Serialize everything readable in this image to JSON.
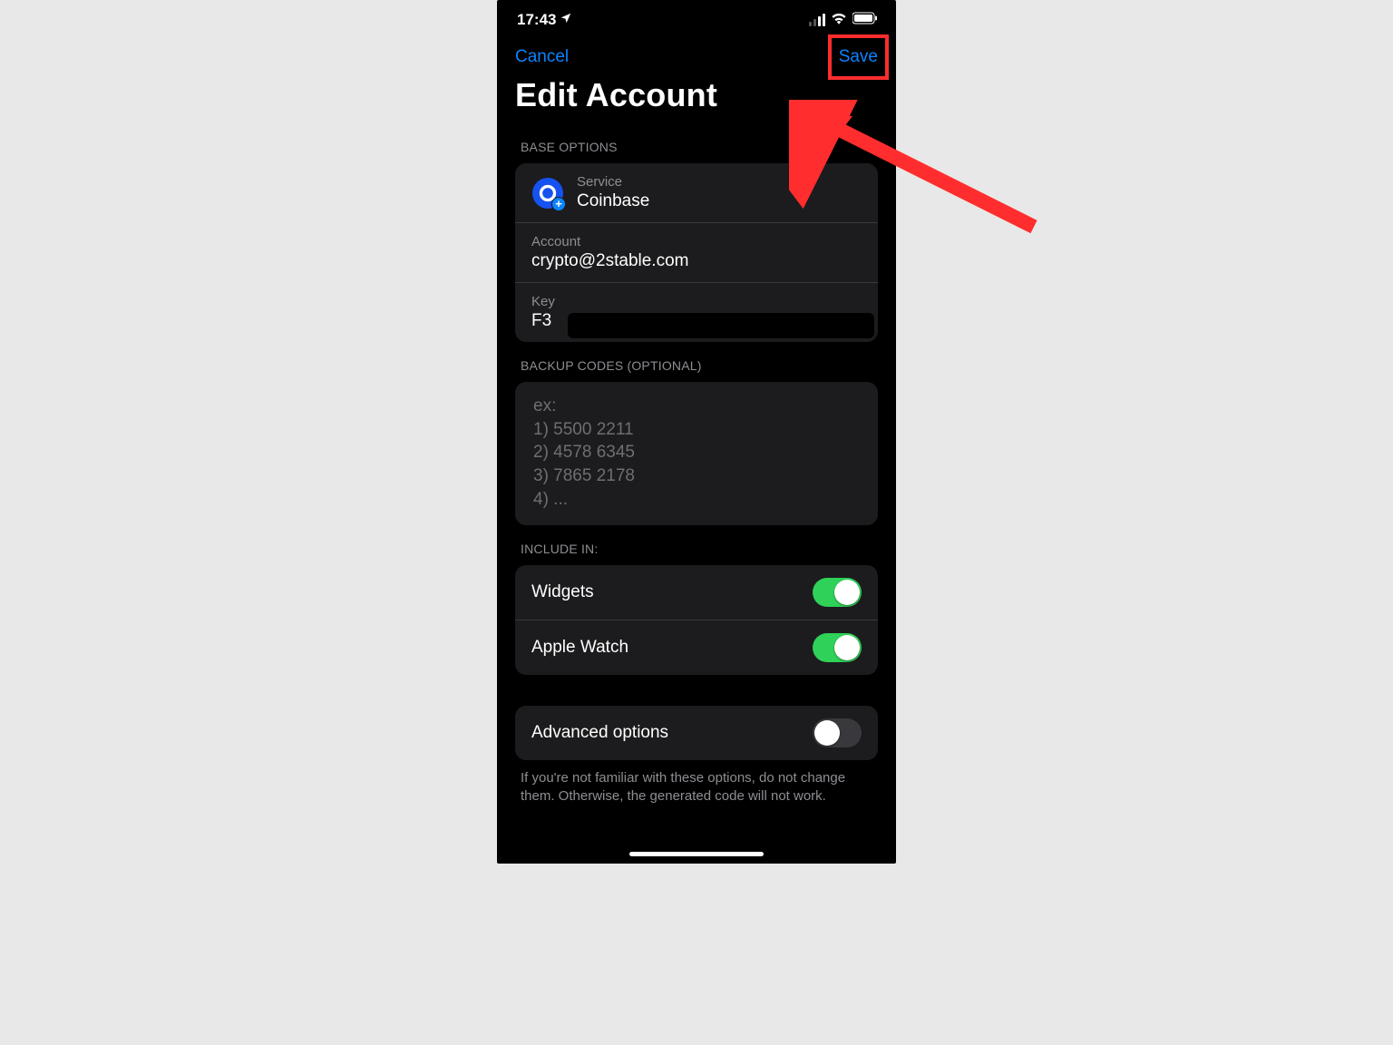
{
  "status": {
    "time": "17:43"
  },
  "nav": {
    "cancel": "Cancel",
    "save": "Save"
  },
  "title": "Edit Account",
  "sections": {
    "base_options": {
      "header": "BASE OPTIONS",
      "service_label": "Service",
      "service_value": "Coinbase",
      "account_label": "Account",
      "account_value": "crypto@2stable.com",
      "key_label": "Key",
      "key_value": "F3"
    },
    "backup": {
      "header": "BACKUP CODES (OPTIONAL)",
      "placeholder": "ex:\n1) 5500 2211\n2) 4578 6345\n3) 7865 2178\n4) ..."
    },
    "include_in": {
      "header": "INCLUDE IN:",
      "widgets_label": "Widgets",
      "widgets_on": true,
      "apple_watch_label": "Apple Watch",
      "apple_watch_on": true
    },
    "advanced": {
      "label": "Advanced options",
      "on": false,
      "footer": "If you're not familiar with these options, do not change them. Otherwise, the generated code will not work."
    }
  },
  "annotation": {
    "highlight_color": "#ff2d2d"
  }
}
